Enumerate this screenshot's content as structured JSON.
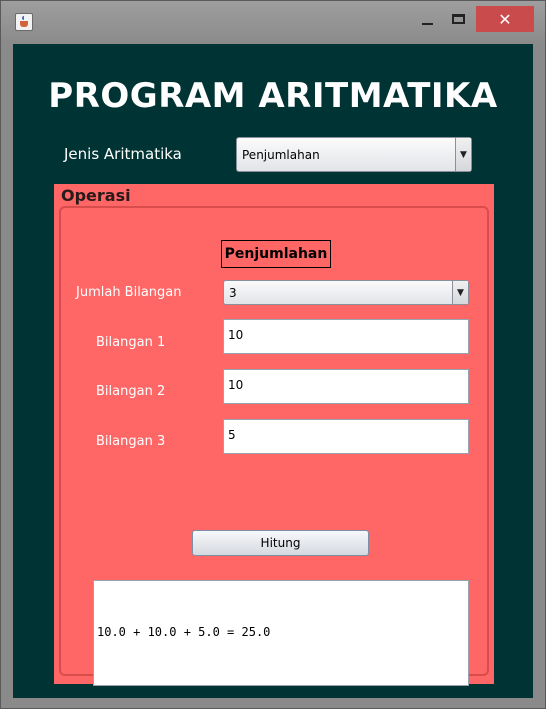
{
  "window": {
    "title": "",
    "icon": "java-cup-icon",
    "controls": {
      "minimize": "minimize-icon",
      "maximize": "maximize-icon",
      "close_label": "✕"
    }
  },
  "app": {
    "title": "PROGRAM ARITMATIKA",
    "jenis_label": "Jenis Aritmatika",
    "jenis_selected": "Penjumlahan"
  },
  "operasi": {
    "title": "Operasi",
    "subtitle": "Penjumlahan",
    "jumlah_label": "Jumlah Bilangan",
    "jumlah_selected": "3",
    "fields": [
      {
        "label": "Bilangan 1",
        "value": "10"
      },
      {
        "label": "Bilangan 2",
        "value": "10"
      },
      {
        "label": "Bilangan 3",
        "value": "5"
      }
    ],
    "button_label": "Hitung",
    "result": "10.0 + 10.0 + 5.0 = 25.0"
  },
  "colors": {
    "background": "#003333",
    "panel": "#ff6666",
    "close_button": "#c94b4b"
  }
}
